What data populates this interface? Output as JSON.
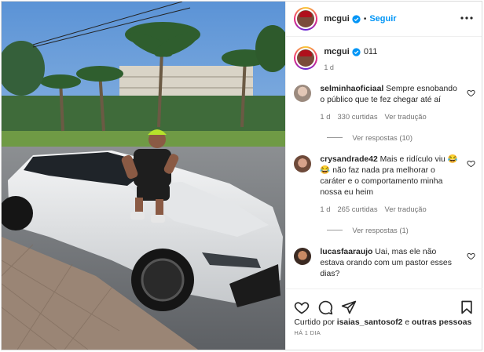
{
  "post": {
    "username": "mcgui",
    "follow_label": "Seguir",
    "separator": "•",
    "caption_text": "011",
    "caption_time": "1 d"
  },
  "comments": [
    {
      "user": "selminhaoficiaal",
      "text": "Sempre esnobando o público que te fez chegar até aí",
      "time": "1 d",
      "likes": "330 curtidas",
      "reply": "Ver tradução",
      "replies": "Ver respostas (10)"
    },
    {
      "user": "crysandrade42",
      "text": "Mais e ridículo viu 😂😂 não faz nada pra melhorar o caráter e o comportamento minha nossa eu heim",
      "time": "1 d",
      "likes": "265 curtidas",
      "reply": "Ver tradução",
      "replies": "Ver respostas (1)"
    },
    {
      "user": "lucasfaaraujo",
      "text": "Uai, mas ele não estava orando com um pastor esses dias?"
    }
  ],
  "footer": {
    "liked_prefix": "Curtido por",
    "liked_user": "isaias_santosof2",
    "liked_and": "e",
    "liked_others": "outras pessoas",
    "date": "HÁ 1 DIA"
  },
  "colors": {
    "accent": "#0095f6",
    "verified": "#0095f6",
    "muted": "#737373",
    "text": "#262626"
  }
}
